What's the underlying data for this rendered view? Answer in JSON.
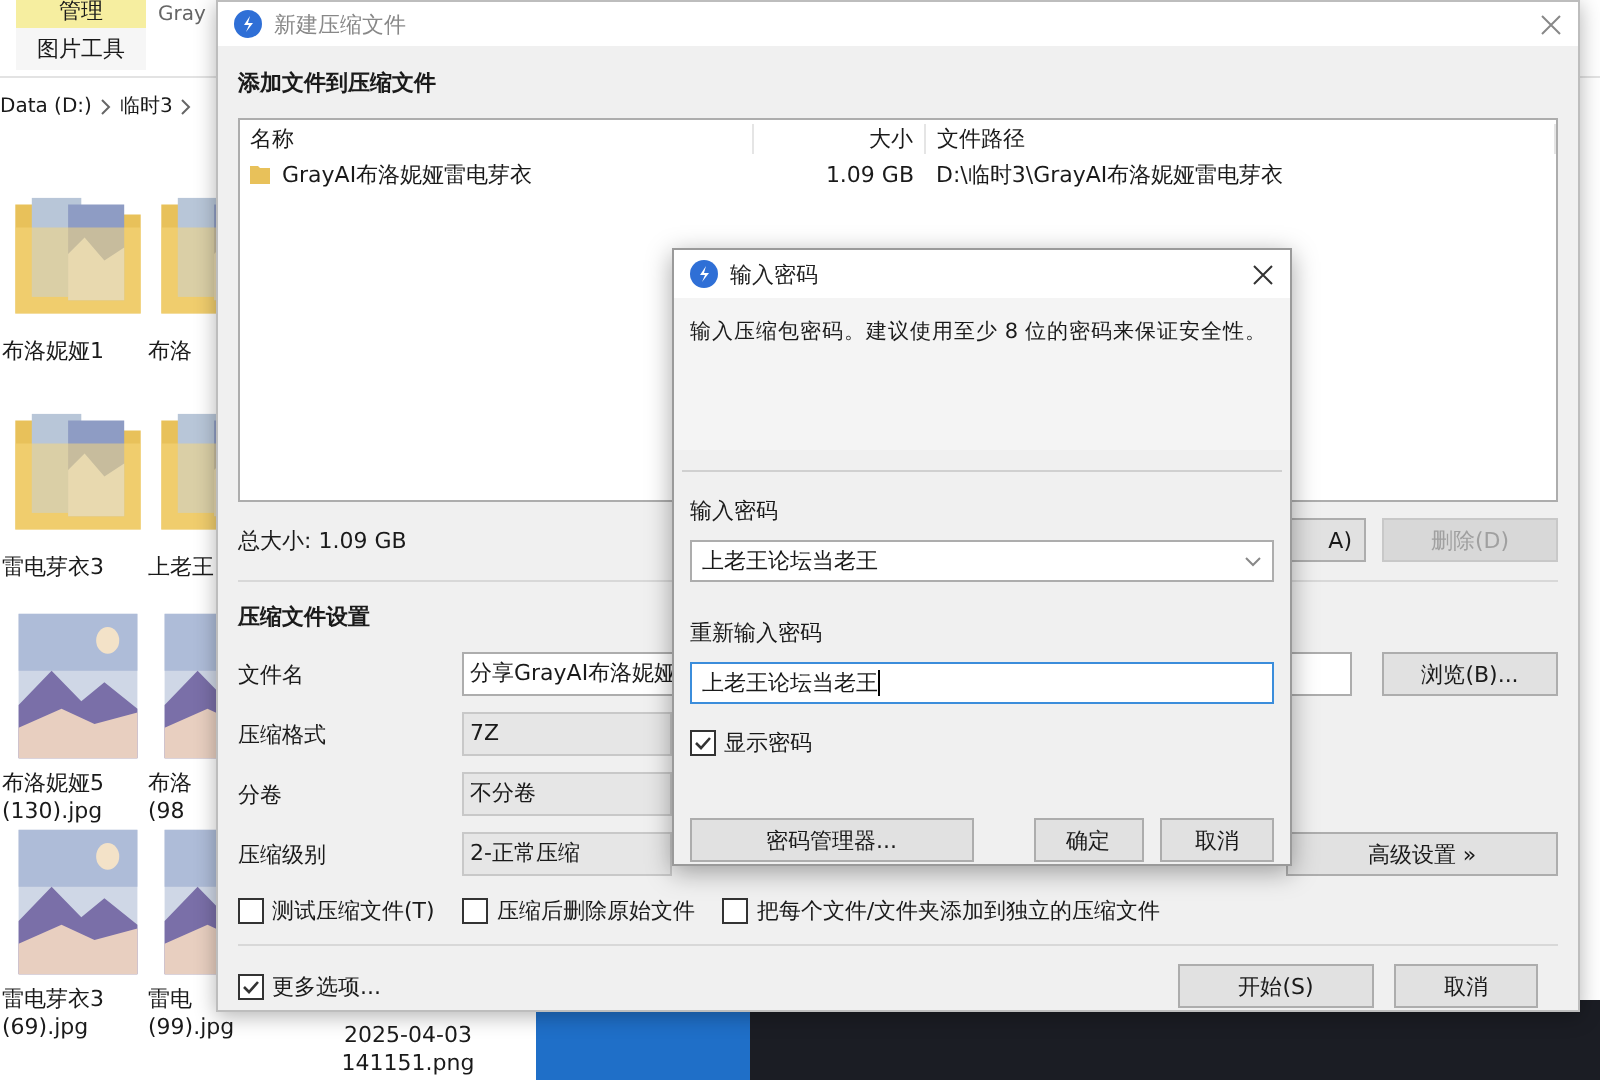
{
  "explorer": {
    "ribbon_tabs": [
      {
        "label": "管理",
        "selected": true
      }
    ],
    "ribbon_group": "图片工具",
    "window_title": "Gray",
    "breadcrumb": [
      "Data (D:)",
      "临时3"
    ],
    "rows": [
      [
        {
          "kind": "folder",
          "lines": [
            "布洛妮娅1"
          ]
        },
        {
          "kind": "folder",
          "lines": [
            "布洛"
          ]
        },
        {}
      ],
      [
        {
          "kind": "folder",
          "lines": [
            "雷电芽衣3"
          ]
        },
        {
          "kind": "folder",
          "lines": [
            "上老王"
          ]
        },
        {}
      ],
      [
        {
          "lines": [
            "布洛妮娅5",
            "(130).jpg"
          ]
        },
        {
          "lines": [
            "布洛",
            "(98"
          ]
        },
        {}
      ],
      [
        {
          "lines": [
            "雷电芽衣3",
            "(69).jpg"
          ]
        },
        {
          "lines": [
            "雷电",
            "(99).jpg"
          ]
        },
        {
          "lines": [
            "2025-04-03",
            "141151.png"
          ]
        }
      ]
    ]
  },
  "archive_dialog": {
    "title": "新建压缩文件",
    "section_files": "添加文件到压缩文件",
    "columns": [
      "名称",
      "大小",
      "文件路径"
    ],
    "files": [
      {
        "name": "GrayAI布洛妮娅雷电芽衣",
        "size": "1.09 GB",
        "path": "D:\\临时3\\GrayAI布洛妮娅雷电芽衣"
      }
    ],
    "total": "总大小: 1.09 GB",
    "add_button": "A)",
    "delete_button": {
      "label": "删除(D)",
      "disabled": true
    },
    "section_settings": "压缩文件设置",
    "fields": [
      {
        "label": "文件名",
        "kind": "text",
        "value": "分享GrayAI布洛妮娅"
      },
      {
        "label": "压缩格式",
        "kind": "select",
        "value": "7Z"
      },
      {
        "label": "分卷",
        "kind": "select",
        "value": "不分卷"
      },
      {
        "label": "压缩级别",
        "kind": "select",
        "value": "2-正常压缩"
      }
    ],
    "browse_button": "浏览(B)...",
    "advanced_button": "高级设置 »",
    "options": [
      {
        "label": "测试压缩文件(T)",
        "checked": false
      },
      {
        "label": "压缩后删除原始文件",
        "checked": false
      },
      {
        "label": "把每个文件/文件夹添加到独立的压缩文件",
        "checked": false
      }
    ],
    "more_options": {
      "label": "更多选项...",
      "checked": true
    },
    "buttons": [
      "开始(S)",
      "取消"
    ]
  },
  "password_dialog": {
    "title": "输入密码",
    "description": "输入压缩包密码。建议使用至少 8 位的密码来保证安全性。",
    "password_label": "输入密码",
    "password": "上老王论坛当老王",
    "repeat_label": "重新输入密码",
    "repeat": "上老王论坛当老王",
    "show_password": {
      "label": "显示密码",
      "checked": true
    },
    "buttons": [
      "密码管理器...",
      "确定",
      "取消"
    ]
  }
}
